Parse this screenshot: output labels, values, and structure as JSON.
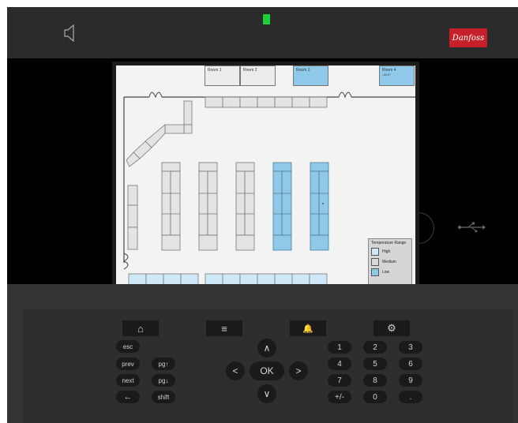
{
  "colors": {
    "led": "#1fcf3a",
    "brand": "#c8202a",
    "temp_low": "#8fc9ea",
    "temp_medium": "#d9d9d9",
    "temp_high": "#cfe8f7"
  },
  "header": {
    "brand_label": "Danfoss"
  },
  "rooms": [
    {
      "label": "Room 1",
      "temp": "",
      "state": "medium"
    },
    {
      "label": "Room 2",
      "temp": "",
      "state": "medium"
    },
    {
      "label": "Room 3",
      "temp": "",
      "state": "low"
    },
    {
      "label": "Room 4",
      "temp": "-20.0°",
      "state": "low"
    }
  ],
  "legend": {
    "title": "Temperature Range",
    "items": [
      {
        "label": "High",
        "state": "high"
      },
      {
        "label": "Medium",
        "state": "medium"
      },
      {
        "label": "Low",
        "state": "low"
      }
    ]
  },
  "function_keys": [
    {
      "name": "home-icon",
      "glyph": "⌂"
    },
    {
      "name": "menu-icon",
      "glyph": "≡"
    },
    {
      "name": "bell-icon",
      "glyph": "🔔"
    },
    {
      "name": "gear-icon",
      "glyph": "⚙"
    }
  ],
  "left_keys": {
    "esc": "esc",
    "prev": "prev",
    "pg_up": "pg↑",
    "next": "next",
    "pg_down": "pg↓",
    "back": "←",
    "shift": "shift"
  },
  "nav_keys": {
    "up": "∧",
    "left": "<",
    "ok": "OK",
    "right": ">",
    "down": "∨"
  },
  "numpad": [
    "1",
    "2",
    "3",
    "4",
    "5",
    "6",
    "7",
    "8",
    "9",
    "+/-",
    "0",
    "."
  ]
}
